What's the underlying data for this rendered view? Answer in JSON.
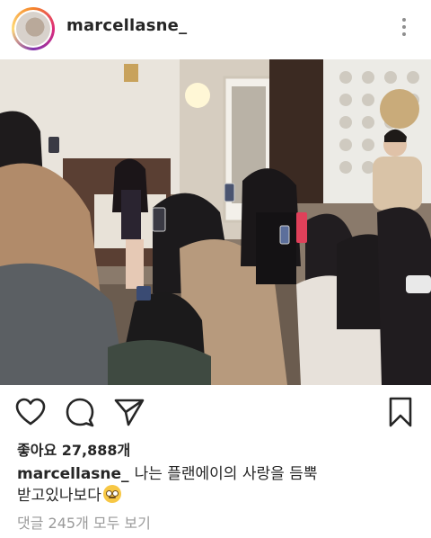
{
  "post": {
    "username": "marcellasne_",
    "likes_text": "좋아요 27,888개",
    "caption_user": "marcellasne_",
    "caption_line1": "나는 플랜에이의 사랑을 듬뿍",
    "caption_line2": "받고있나보다",
    "caption_emoji": "face-with-rolling-eyes-emoji",
    "view_comments": "댓글 245개 모두 보기"
  },
  "icons": {
    "more": "more-options-icon",
    "like": "heart-icon",
    "comment": "comment-icon",
    "share": "send-icon",
    "save": "bookmark-icon"
  },
  "colors": {
    "text": "#262626",
    "muted": "#9a9a9a",
    "ring_start": "#f58529",
    "ring_end": "#8134af"
  }
}
